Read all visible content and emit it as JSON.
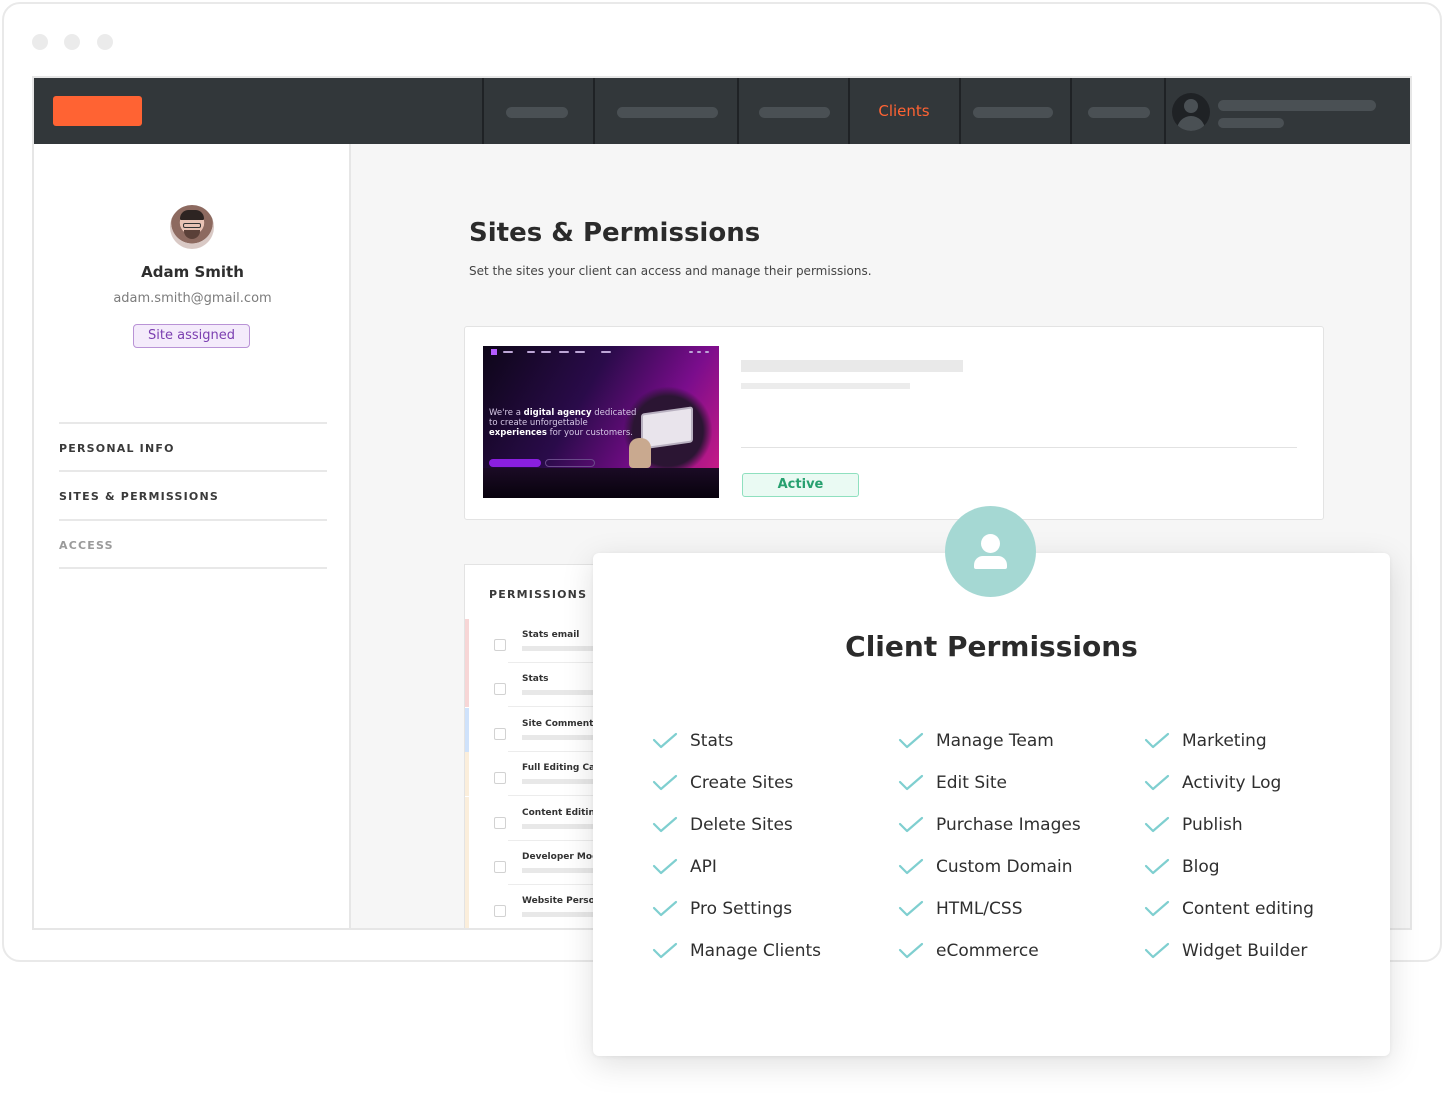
{
  "nav": {
    "active_item": "Clients",
    "accent_color": "#ff6333"
  },
  "sidebar": {
    "user_name": "Adam Smith",
    "user_email": "adam.smith@gmail.com",
    "badge": "Site assigned",
    "links": [
      "PERSONAL INFO",
      "SITES & PERMISSIONS",
      "ACCESS"
    ]
  },
  "main": {
    "title": "Sites & Permissions",
    "subtitle": "Set the sites your client can access and manage their permissions.",
    "site": {
      "status": "Active",
      "thumbnail_text": {
        "lead": "We're a ",
        "bold1": "digital agency",
        "mid": " dedicated to create unforgettable ",
        "bold2": "experiences",
        "tail": " for your customers."
      }
    },
    "permissions": {
      "heading": "PERMISSIONS",
      "rows": [
        "Stats email",
        "Stats",
        "Site Comments",
        "Full Editing Cap",
        "Content Editing",
        "Developer Mode",
        "Website Persona"
      ]
    }
  },
  "overlay": {
    "title": "Client Permissions",
    "check_color": "#7fcfd0",
    "columns": [
      [
        "Stats",
        "Create Sites",
        "Delete Sites",
        "API",
        "Pro Settings",
        "Manage Clients"
      ],
      [
        "Manage Team",
        "Edit Site",
        "Purchase Images",
        "Custom Domain",
        "HTML/CSS",
        "eCommerce"
      ],
      [
        "Marketing",
        "Activity Log",
        "Publish",
        "Blog",
        "Content editing",
        "Widget Builder"
      ]
    ]
  }
}
